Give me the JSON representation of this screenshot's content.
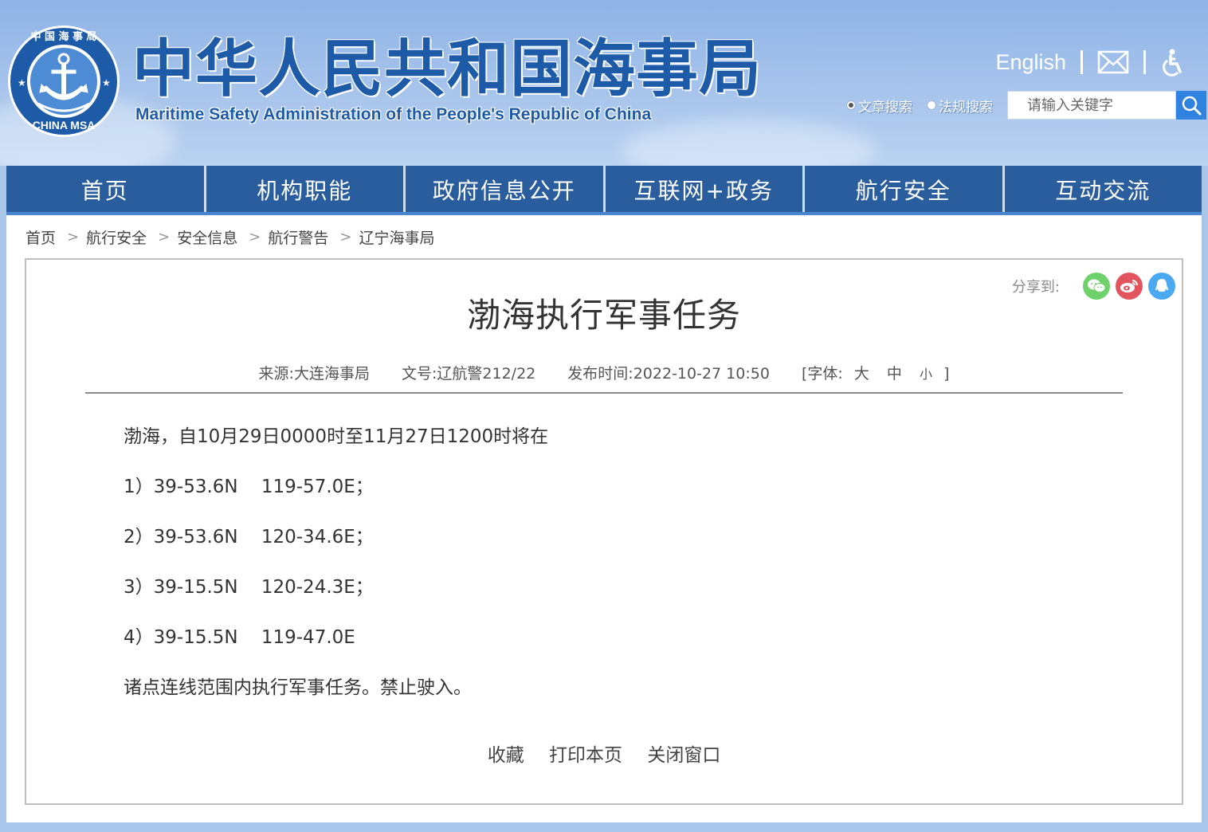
{
  "header": {
    "title": "中华人民共和国海事局",
    "subtitle": "Maritime Safety Administration of the People's Republic of China",
    "logo_top_text": "中 国 海 事 局",
    "logo_bottom_text": "CHINA MSA",
    "english_link": "English",
    "icons": [
      "mail-icon",
      "accessibility-icon",
      "search-icon"
    ]
  },
  "search": {
    "options": [
      "文章搜索",
      "法规搜索"
    ],
    "selected": "文章搜索",
    "placeholder": "请输入关键字"
  },
  "nav": [
    "首页",
    "机构职能",
    "政府信息公开",
    "互联网+政务",
    "航行安全",
    "互动交流"
  ],
  "breadcrumb": [
    "首页",
    "航行安全",
    "安全信息",
    "航行警告",
    "辽宁海事局"
  ],
  "share": {
    "label": "分享到:",
    "icons": [
      "wechat-icon",
      "weibo-icon",
      "qq-icon"
    ],
    "colors": [
      "#6fd16b",
      "#e2555f",
      "#4ba9f2"
    ]
  },
  "article": {
    "title": "渤海执行军事任务",
    "source_label": "来源:",
    "source": "大连海事局",
    "doc_no_label": "文号:",
    "doc_no": "辽航警212/22",
    "publish_label": "发布时间:",
    "publish_time": "2022-10-27 10:50",
    "font_label": "[字体:",
    "font_large": "大",
    "font_medium": "中",
    "font_small": "小",
    "font_close": "]",
    "paragraphs": [
      "渤海，自10月29日0000时至11月27日1200时将在",
      "1）39-53.6N    119-57.0E；",
      "2）39-53.6N    120-34.6E；",
      "3）39-15.5N    120-24.3E；",
      "4）39-15.5N    119-47.0E",
      "诸点连线范围内执行军事任务。禁止驶入。"
    ]
  },
  "actions": [
    "收藏",
    "打印本页",
    "关闭窗口"
  ],
  "colors": {
    "nav_bg": "#2a5d9d",
    "header_title": "#1d5aa8",
    "search_button": "#2f82e0"
  }
}
